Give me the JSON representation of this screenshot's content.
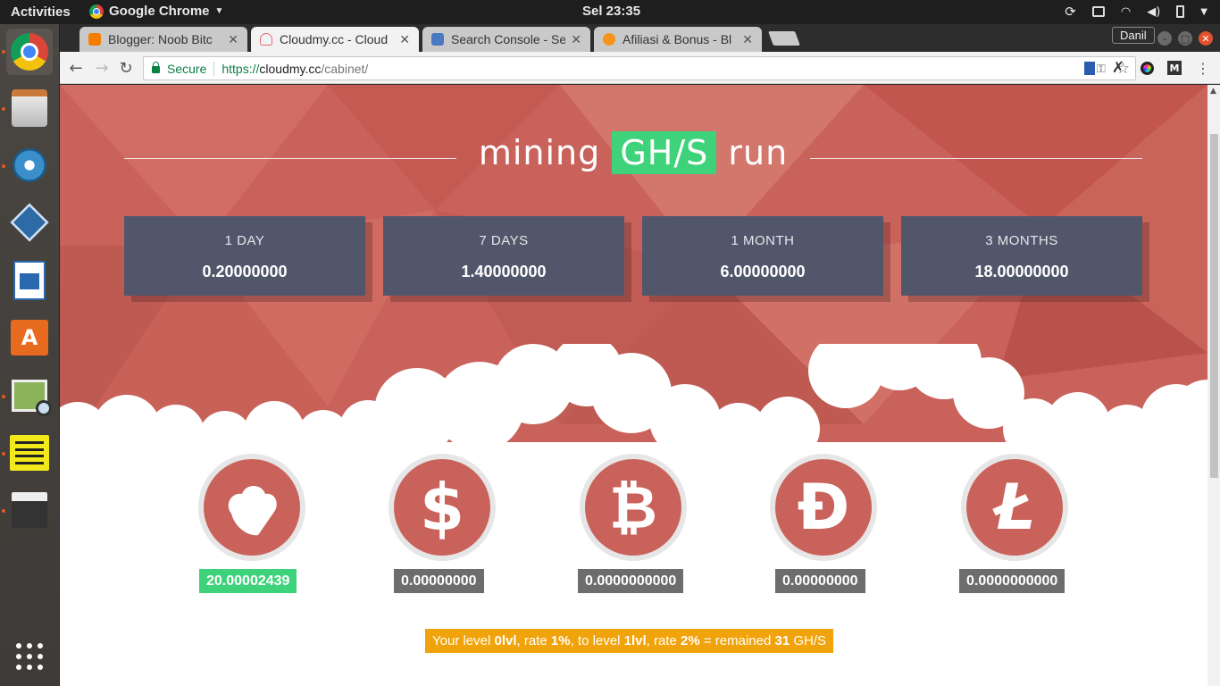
{
  "topbar": {
    "activities": "Activities",
    "app_name": "Google Chrome",
    "clock": "Sel 23:35"
  },
  "tabs": [
    {
      "label": "Blogger: Noob Bitc",
      "favicon_color": "#f57d00"
    },
    {
      "label": "Cloudmy.cc - Cloud",
      "favicon_color": "#e07070"
    },
    {
      "label": "Search Console - Se",
      "favicon_color": "#4a78c2"
    },
    {
      "label": "Afiliasi & Bonus - Bl",
      "favicon_color": "#f7931a"
    }
  ],
  "profile_name": "Danil",
  "address_bar": {
    "secure_label": "Secure",
    "scheme": "https://",
    "host": "cloudmy.cc",
    "path": "/cabinet/"
  },
  "hero": {
    "title_before": "mining",
    "title_highlight": "GH/S",
    "title_after": "run"
  },
  "stats": [
    {
      "period": "1 DAY",
      "value": "0.20000000"
    },
    {
      "period": "7 DAYS",
      "value": "1.40000000"
    },
    {
      "period": "1 MONTH",
      "value": "6.00000000"
    },
    {
      "period": "3 MONTHS",
      "value": "18.00000000"
    }
  ],
  "balances": [
    {
      "icon": "cloud-icon",
      "glyph": "",
      "value": "20.00002439"
    },
    {
      "icon": "dollar-icon",
      "glyph": "$",
      "value": "0.00000000"
    },
    {
      "icon": "bitcoin-icon",
      "glyph": "₿",
      "value": "0.0000000000"
    },
    {
      "icon": "dogecoin-icon",
      "glyph": "Đ",
      "value": "0.00000000"
    },
    {
      "icon": "litecoin-icon",
      "glyph": "Ł",
      "value": "0.0000000000"
    }
  ],
  "level_banner": {
    "t1": "Your level ",
    "level": "0lvl",
    "t2": ", rate ",
    "rate": "1%",
    "t3": ", to level ",
    "next_level": "1lvl",
    "t4": ", rate ",
    "next_rate": "2%",
    "t5": " = remained ",
    "remaining": "31",
    "t6": " GH/S"
  },
  "colors": {
    "hero_bg": "#c9625a",
    "stat_box": "#52566b",
    "highlight_green": "#3ed27a",
    "level_orange": "#f0a30a"
  }
}
